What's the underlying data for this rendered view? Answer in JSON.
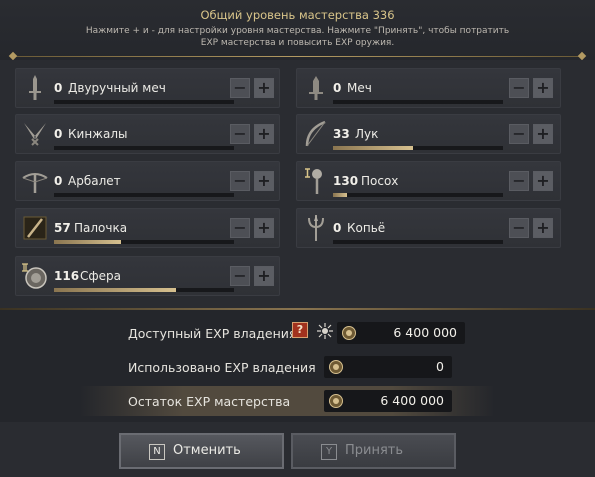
{
  "header": {
    "title": "Общий уровень мастерства 336",
    "subtitle_line1": "Нажмите + и - для настройки уровня мастерства. Нажмите \"Принять\", чтобы потратить",
    "subtitle_line2": "EXP мастерства и повысить EXP оружия."
  },
  "weapons": [
    {
      "id": "greatsword",
      "level": "0",
      "name": "Двуручный меч",
      "progress": 0,
      "icon": "greatsword-icon"
    },
    {
      "id": "sword",
      "level": "0",
      "name": "Меч",
      "progress": 0,
      "icon": "sword-icon"
    },
    {
      "id": "daggers",
      "level": "0",
      "name": "Кинжалы",
      "progress": 0,
      "icon": "daggers-icon"
    },
    {
      "id": "bow",
      "level": "33",
      "name": "Лук",
      "progress": 0.47,
      "icon": "bow-icon"
    },
    {
      "id": "crossbow",
      "level": "0",
      "name": "Арбалет",
      "progress": 0,
      "icon": "crossbow-icon"
    },
    {
      "id": "staff",
      "level": "130",
      "name": "Посох",
      "progress": 0.08,
      "icon": "staff-icon"
    },
    {
      "id": "wand",
      "level": "57",
      "name": "Палочка",
      "progress": 0.37,
      "icon": "wand-icon"
    },
    {
      "id": "spear",
      "level": "0",
      "name": "Копьё",
      "progress": 0,
      "icon": "spear-icon"
    },
    {
      "id": "orb",
      "level": "116",
      "name": "Сфера",
      "progress": 0.68,
      "icon": "orb-icon"
    }
  ],
  "controls": {
    "minus": "−",
    "plus": "+"
  },
  "exp": {
    "available_label": "Доступный EXP владения",
    "available_value": "6 400 000",
    "help": "?",
    "used_label": "Использовано EXP владения",
    "used_value": "0",
    "remaining_label": "Остаток EXP мастерства",
    "remaining_value": "6 400 000"
  },
  "footer": {
    "cancel_key": "N",
    "cancel_label": "Отменить",
    "accept_key": "Y",
    "accept_label": "Принять"
  },
  "colors": {
    "accent": "#d6c08f",
    "gold": "#d9c58a"
  }
}
